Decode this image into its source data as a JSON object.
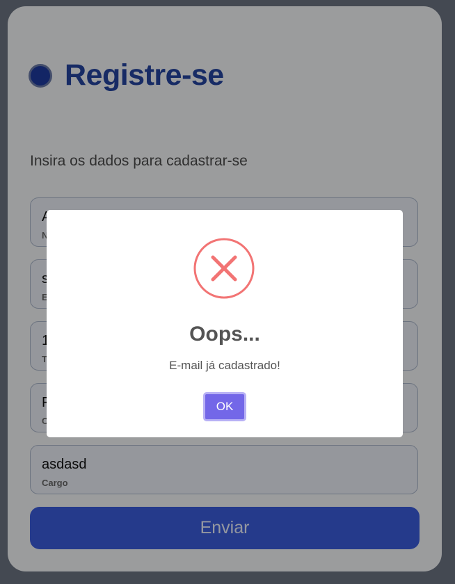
{
  "form": {
    "title": "Registre-se",
    "subtitle": "Insira os dados para cadastrar-se",
    "fields": [
      {
        "value": "A",
        "label": "N"
      },
      {
        "value": "s",
        "label": "E"
      },
      {
        "value": "1",
        "label": "T"
      },
      {
        "value": "F",
        "label": "C"
      },
      {
        "value": "asdasd",
        "label": "Cargo"
      }
    ],
    "submit_label": "Enviar"
  },
  "dialog": {
    "icon": "error-x-icon",
    "title": "Oops...",
    "message": "E-mail já cadastrado!",
    "ok_label": "OK",
    "accent_color": "#f27474",
    "button_color": "#7367f0"
  },
  "colors": {
    "brand": "#24449e",
    "submit": "#3b5bd9"
  }
}
